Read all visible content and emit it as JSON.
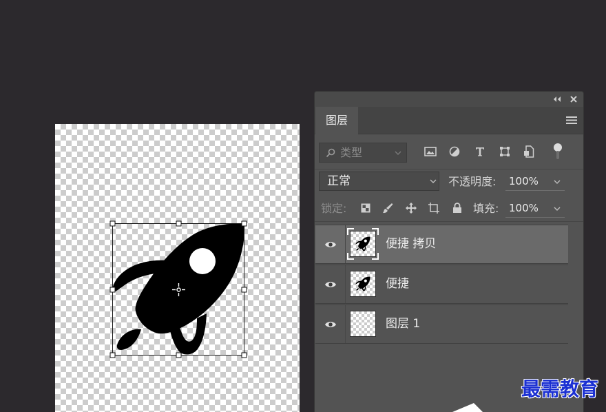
{
  "panel": {
    "tab_label": "图层",
    "header_icons": [
      "collapse-panel-icon",
      "close-icon",
      "panel-menu-icon"
    ]
  },
  "filter": {
    "kind_label": "类型",
    "icons": [
      "pixel-layer-filter-icon",
      "adjustment-layer-filter-icon",
      "type-layer-filter-icon",
      "shape-layer-filter-icon",
      "smart-object-filter-icon",
      "filter-toggle-icon"
    ]
  },
  "blend": {
    "mode": "正常",
    "opacity_label": "不透明度:",
    "opacity_value": "100%"
  },
  "lock": {
    "label": "锁定:",
    "icons": [
      "lock-transparent-pixels-icon",
      "lock-image-pixels-icon",
      "lock-position-icon",
      "lock-artboard-icon",
      "lock-all-icon"
    ],
    "fill_label": "填充:",
    "fill_value": "100%"
  },
  "layers": [
    {
      "name": "便捷 拷贝",
      "visible": true,
      "selected": true,
      "thumbnail_icon": "rocket-thumbnail-icon"
    },
    {
      "name": "便捷",
      "visible": true,
      "selected": false,
      "thumbnail_icon": "rocket-thumbnail-icon"
    },
    {
      "name": "图层 1",
      "visible": true,
      "selected": false,
      "thumbnail_icon": "transparent-thumbnail-icon"
    }
  ],
  "canvas": {
    "artwork_icon": "rocket-icon",
    "transform_active": true
  },
  "watermark": {
    "text": "最需教育"
  },
  "colors": {
    "app_background": "#2c292d",
    "panel_background": "#535353",
    "selected_layer": "#6a6a6a",
    "watermark": "#1b30d2"
  }
}
